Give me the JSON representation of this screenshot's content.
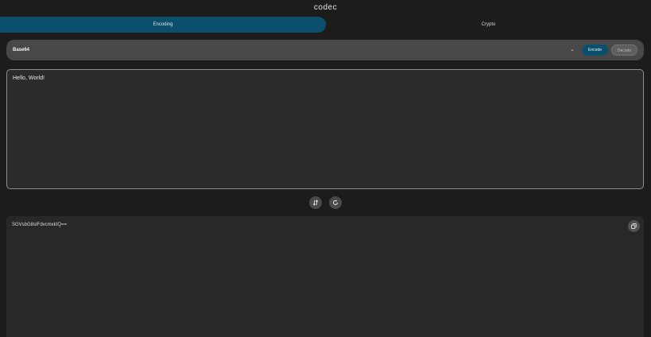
{
  "app": {
    "title": "codec"
  },
  "tabs": [
    {
      "label": "Encoding",
      "active": true
    },
    {
      "label": "Crypto",
      "active": false
    }
  ],
  "toolbar": {
    "selected_codec": "Base64",
    "dropdown_icon": "chevron-down-icon",
    "encode_label": "Encode",
    "decode_label": "Decode",
    "active_mode": "Encode"
  },
  "input": {
    "value": "Hello, World!"
  },
  "actions": {
    "swap_icon": "swap-vertical-icon",
    "reset_icon": "refresh-icon"
  },
  "output": {
    "value": "SGVsbG8sIFdvcmxkIQ==",
    "copy_icon": "copy-icon"
  },
  "colors": {
    "background": "#1c1c1c",
    "accent": "#0b4f6c",
    "bar": "#484848",
    "input_bg": "#2b2b2b",
    "output_bg": "#282828"
  }
}
